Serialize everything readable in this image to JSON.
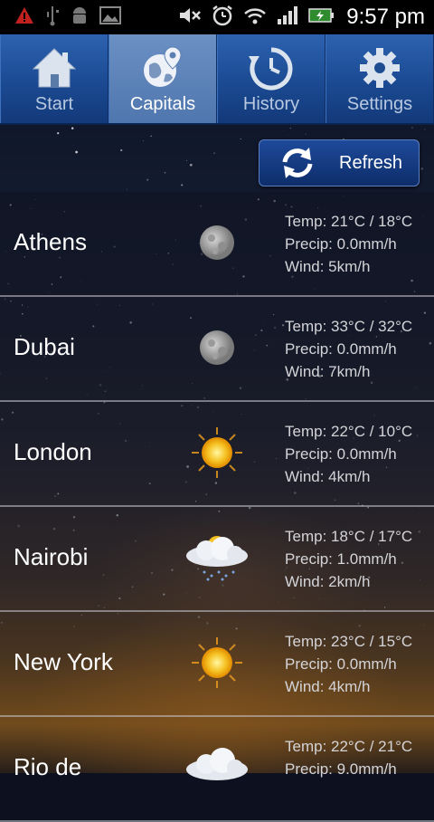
{
  "statusbar": {
    "time": "9:57 pm",
    "left_icons": [
      "warning-icon",
      "usb-icon",
      "android-debug-icon",
      "image-icon"
    ],
    "right_icons": [
      "mute-icon",
      "alarm-icon",
      "wifi-icon",
      "signal-icon",
      "battery-icon"
    ]
  },
  "tabs": [
    {
      "label": "Start",
      "icon": "home-icon",
      "active": false
    },
    {
      "label": "Capitals",
      "icon": "globe-pin-icon",
      "active": true
    },
    {
      "label": "History",
      "icon": "history-clock-icon",
      "active": false
    },
    {
      "label": "Settings",
      "icon": "gear-icon",
      "active": false
    }
  ],
  "refresh_button": {
    "label": "Refresh",
    "icon": "refresh-icon"
  },
  "capitals": [
    {
      "city": "Athens",
      "icon": "moon-icon",
      "temp": "Temp: 21°C / 18°C",
      "precip": "Precip: 0.0mm/h",
      "wind": "Wind: 5km/h"
    },
    {
      "city": "Dubai",
      "icon": "moon-icon",
      "temp": "Temp: 33°C / 32°C",
      "precip": "Precip: 0.0mm/h",
      "wind": "Wind: 7km/h"
    },
    {
      "city": "London",
      "icon": "sun-icon",
      "temp": "Temp: 22°C / 10°C",
      "precip": "Precip: 0.0mm/h",
      "wind": "Wind: 4km/h"
    },
    {
      "city": "Nairobi",
      "icon": "cloud-rain-sun-icon",
      "temp": "Temp: 18°C / 17°C",
      "precip": "Precip: 1.0mm/h",
      "wind": "Wind: 2km/h"
    },
    {
      "city": "New York",
      "icon": "sun-icon",
      "temp": "Temp: 23°C / 15°C",
      "precip": "Precip: 0.0mm/h",
      "wind": "Wind: 4km/h"
    },
    {
      "city": "Rio de",
      "icon": "cloud-icon",
      "temp": "Temp: 22°C / 21°C",
      "precip": "Precip: 9.0mm/h",
      "wind": ""
    }
  ]
}
